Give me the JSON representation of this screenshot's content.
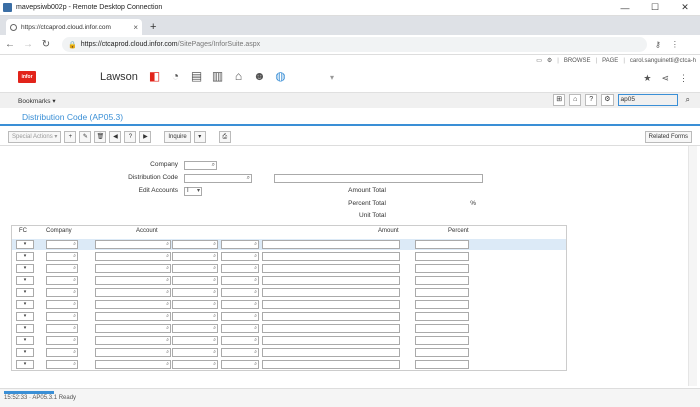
{
  "rdp": {
    "title": "mavepsiwb002p - Remote Desktop Connection",
    "min": "—",
    "max": "☐",
    "close": "✕"
  },
  "browser": {
    "tab_title": "https://ctcaprod.cloud.infor.com",
    "tab_close": "×",
    "new_tab": "+",
    "url_host": "https://ctcaprod.cloud.infor.com",
    "url_path": "/SitePages/InforSuite.aspx",
    "back": "←",
    "forward": "→",
    "reload": "↻"
  },
  "app": {
    "logo": "infor",
    "product": "Lawson",
    "util_browse": "BROWSE",
    "util_page": "PAGE",
    "user": "carol.sanguinetti@ctca-h",
    "bookmarks": "Bookmarks ▾",
    "search_value": "ap05"
  },
  "form": {
    "title": "Distribution Code (AP05.3)",
    "special_actions": "Special Actions ▾",
    "inquire": "Inquire",
    "related_forms": "Related Forms",
    "labels": {
      "company": "Company",
      "distribution_code": "Distribution Code",
      "edit_accounts": "Edit Accounts",
      "amount_total": "Amount Total",
      "percent_total": "Percent Total",
      "percent_sign": "%",
      "unit_total": "Unit Total"
    },
    "edit_accounts_value": "I"
  },
  "grid": {
    "headers": {
      "fc": "FC",
      "company": "Company",
      "account": "Account",
      "amount": "Amount",
      "percent": "Percent"
    },
    "row_count": 11
  },
  "status": {
    "text": "15:52:33 · AP05.3.1 Ready"
  }
}
